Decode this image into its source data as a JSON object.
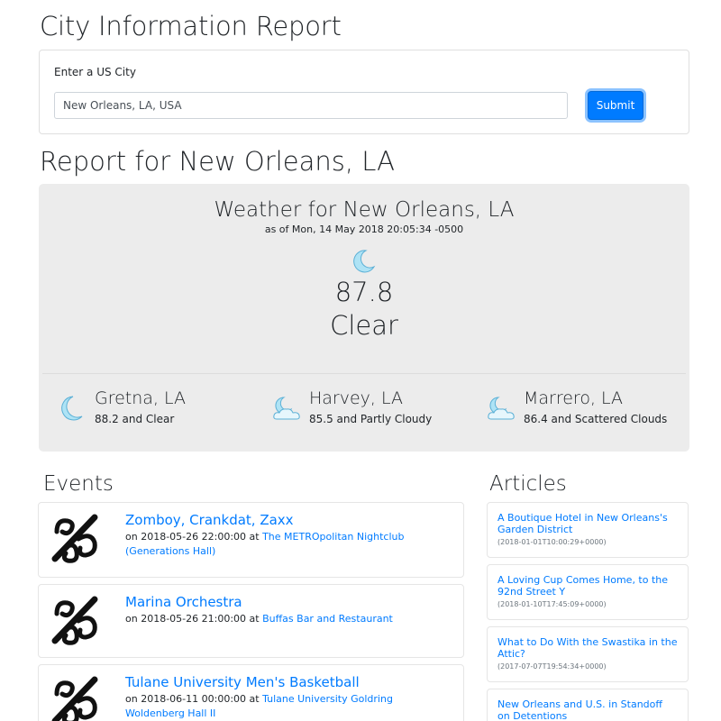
{
  "page": {
    "title": "City Information Report"
  },
  "form": {
    "label": "Enter a US City",
    "input_value": "New Orleans, LA, USA",
    "submit_label": "Submit"
  },
  "report": {
    "title": "Report for New Orleans, LA",
    "weather": {
      "title": "Weather for New Orleans, LA",
      "as_of": "as of Mon, 14 May 2018 20:05:34 -0500",
      "icon": "moon-icon",
      "temperature": "87.8",
      "condition": "Clear"
    },
    "nearby": [
      {
        "name": "Gretna, LA",
        "desc": "88.2 and Clear",
        "icon": "moon-icon"
      },
      {
        "name": "Harvey, LA",
        "desc": "85.5 and Partly Cloudy",
        "icon": "cloud-moon-icon"
      },
      {
        "name": "Marrero, LA",
        "desc": "86.4 and Scattered Clouds",
        "icon": "cloud-moon-icon"
      }
    ]
  },
  "events": {
    "title": "Events",
    "items": [
      {
        "name": "Zomboy, Crankdat, Zaxx",
        "prefix": "on 2018-05-26 22:00:00 at ",
        "venue": "The METROpolitan Nightclub (Generations Hall)"
      },
      {
        "name": "Marina Orchestra",
        "prefix": "on 2018-05-26 21:00:00 at ",
        "venue": "Buffas Bar and Restaurant"
      },
      {
        "name": "Tulane University Men's Basketball",
        "prefix": "on 2018-06-11 00:00:00 at ",
        "venue": "Tulane University Goldring Woldenberg Hall II"
      }
    ]
  },
  "articles": {
    "title": "Articles",
    "items": [
      {
        "title": "A Boutique Hotel in New Orleans's Garden District",
        "date": "(2018-01-01T10:00:29+0000)"
      },
      {
        "title": "A Loving Cup Comes Home, to the 92nd Street Y",
        "date": "(2018-01-10T17:45:09+0000)"
      },
      {
        "title": "What to Do With the Swastika in the Attic?",
        "date": "(2017-07-07T19:54:34+0000)"
      },
      {
        "title": "New Orleans and U.S. in Standoff on Detentions",
        "date": ""
      }
    ]
  },
  "colors": {
    "link": "#007bff",
    "panel": "#ececec",
    "button": "#007bff",
    "icon_moon": "#aee3f5"
  }
}
